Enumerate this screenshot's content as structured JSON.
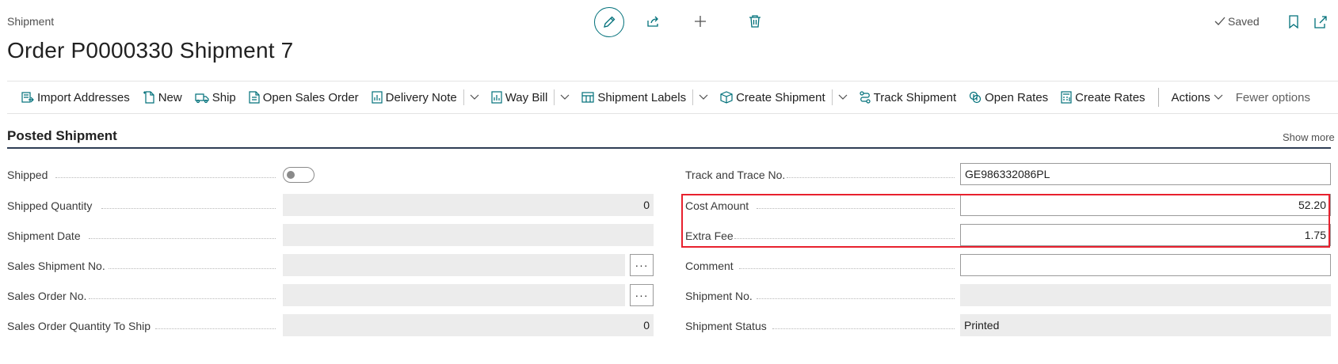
{
  "header": {
    "breadcrumb": "Shipment",
    "title": "Order P0000330 Shipment 7",
    "saved_label": "Saved"
  },
  "action_bar": {
    "items": [
      {
        "label": "Import Addresses",
        "icon": "import-addresses-icon"
      },
      {
        "label": "New",
        "icon": "new-document-icon"
      },
      {
        "label": "Ship",
        "icon": "truck-icon"
      },
      {
        "label": "Open Sales Order",
        "icon": "document-icon"
      },
      {
        "label": "Delivery Note",
        "icon": "report-icon"
      },
      {
        "label": "Way Bill",
        "icon": "report-icon"
      },
      {
        "label": "Shipment Labels",
        "icon": "table-icon"
      },
      {
        "label": "Create Shipment",
        "icon": "package-icon"
      },
      {
        "label": "Track Shipment",
        "icon": "route-icon"
      },
      {
        "label": "Open Rates",
        "icon": "rates-icon"
      },
      {
        "label": "Create Rates",
        "icon": "calculator-icon"
      }
    ],
    "actions_label": "Actions",
    "fewer_options_label": "Fewer options"
  },
  "section": {
    "title": "Posted Shipment",
    "show_more_label": "Show more"
  },
  "left_fields": [
    {
      "label": "Shipped",
      "value": "",
      "type": "toggle",
      "checked": false
    },
    {
      "label": "Shipped Quantity",
      "value": "0",
      "type": "readonly-number"
    },
    {
      "label": "Shipment Date",
      "value": "",
      "type": "readonly"
    },
    {
      "label": "Sales Shipment No.",
      "value": "",
      "type": "readonly-lookup"
    },
    {
      "label": "Sales Order No.",
      "value": "",
      "type": "readonly-lookup"
    },
    {
      "label": "Sales Order Quantity To Ship",
      "value": "0",
      "type": "readonly-number"
    }
  ],
  "right_fields": [
    {
      "label": "Track and Trace No.",
      "value": "GE986332086PL",
      "type": "editable"
    },
    {
      "label": "Cost Amount",
      "value": "52.20",
      "type": "editable-number",
      "highlighted": true
    },
    {
      "label": "Extra Fee",
      "value": "1.75",
      "type": "editable-number",
      "highlighted": true
    },
    {
      "label": "Comment",
      "value": "",
      "type": "editable"
    },
    {
      "label": "Shipment No.",
      "value": "",
      "type": "readonly"
    },
    {
      "label": "Shipment Status",
      "value": "Printed",
      "type": "readonly"
    }
  ],
  "lookup_label": "···",
  "colors": {
    "accent": "#00707a",
    "highlight": "#e8212e",
    "section_rule": "#2e3d55",
    "readonly_bg": "#ececec"
  }
}
